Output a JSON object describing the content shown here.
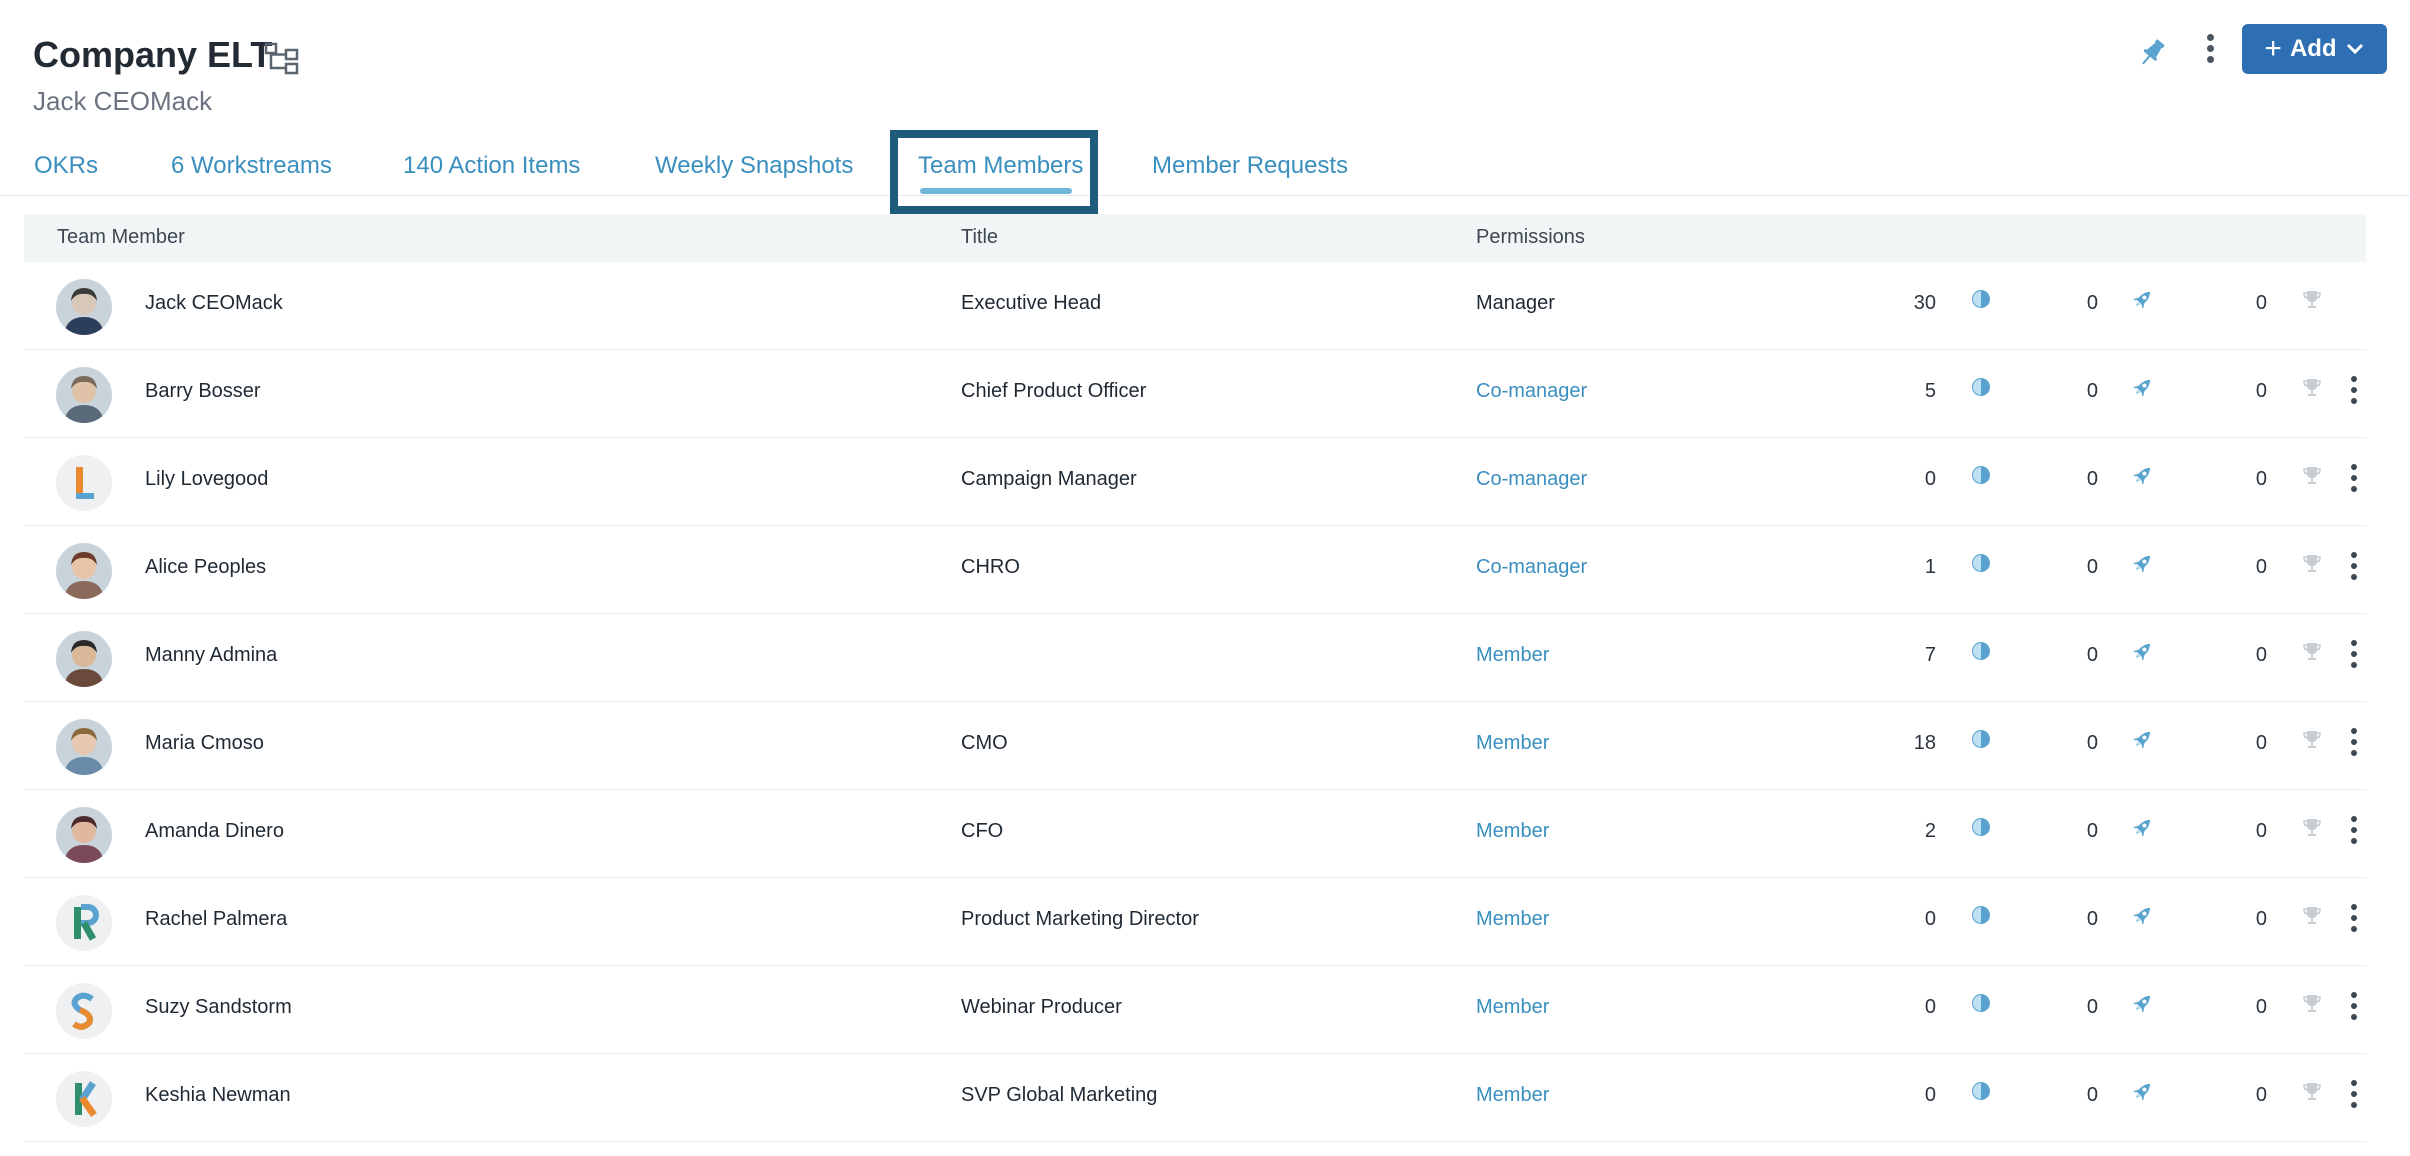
{
  "header": {
    "title": "Company ELT",
    "subtitle": "Jack CEOMack",
    "add_button_label": "Add"
  },
  "icons": {
    "org_chart": "org-chart-icon",
    "pin": "pin-icon",
    "more": "more-vertical-icon",
    "okr": "half-circle-icon",
    "initiative": "rocket-icon",
    "achievement": "trophy-icon"
  },
  "colors": {
    "accent": "#3a8fbf",
    "primary_button": "#2e6eb3",
    "active_tab_box": "#1e5b7c",
    "active_tab_underline": "#6fb7d9"
  },
  "tabs": [
    {
      "label": "OKRs"
    },
    {
      "label": "6 Workstreams"
    },
    {
      "label": "140 Action Items"
    },
    {
      "label": "Weekly Snapshots"
    },
    {
      "label": "Team Members",
      "active": true
    },
    {
      "label": "Member Requests"
    }
  ],
  "table": {
    "columns": [
      "Team Member",
      "Title",
      "Permissions"
    ],
    "rows": [
      {
        "name": "Jack CEOMack",
        "title": "Executive Head",
        "permission": "Manager",
        "okrs": "30",
        "initiatives": "0",
        "achievements": "0",
        "has_menu": false,
        "avatar": "photo"
      },
      {
        "name": "Barry Bosser",
        "title": "Chief Product Officer",
        "permission": "Co-manager",
        "okrs": "5",
        "initiatives": "0",
        "achievements": "0",
        "has_menu": true,
        "avatar": "photo"
      },
      {
        "name": "Lily Lovegood",
        "title": "Campaign Manager",
        "permission": "Co-manager",
        "okrs": "0",
        "initiatives": "0",
        "achievements": "0",
        "has_menu": true,
        "avatar": "L"
      },
      {
        "name": "Alice Peoples",
        "title": "CHRO",
        "permission": "Co-manager",
        "okrs": "1",
        "initiatives": "0",
        "achievements": "0",
        "has_menu": true,
        "avatar": "photo"
      },
      {
        "name": "Manny Admina",
        "title": "",
        "permission": "Member",
        "okrs": "7",
        "initiatives": "0",
        "achievements": "0",
        "has_menu": true,
        "avatar": "photo"
      },
      {
        "name": "Maria Cmoso",
        "title": "CMO",
        "permission": "Member",
        "okrs": "18",
        "initiatives": "0",
        "achievements": "0",
        "has_menu": true,
        "avatar": "photo"
      },
      {
        "name": "Amanda Dinero",
        "title": "CFO",
        "permission": "Member",
        "okrs": "2",
        "initiatives": "0",
        "achievements": "0",
        "has_menu": true,
        "avatar": "photo"
      },
      {
        "name": "Rachel Palmera",
        "title": "Product Marketing Director",
        "permission": "Member",
        "okrs": "0",
        "initiatives": "0",
        "achievements": "0",
        "has_menu": true,
        "avatar": "R"
      },
      {
        "name": "Suzy Sandstorm",
        "title": "Webinar Producer",
        "permission": "Member",
        "okrs": "0",
        "initiatives": "0",
        "achievements": "0",
        "has_menu": true,
        "avatar": "S"
      },
      {
        "name": "Keshia Newman",
        "title": "SVP Global Marketing",
        "permission": "Member",
        "okrs": "0",
        "initiatives": "0",
        "achievements": "0",
        "has_menu": true,
        "avatar": "K"
      }
    ]
  }
}
